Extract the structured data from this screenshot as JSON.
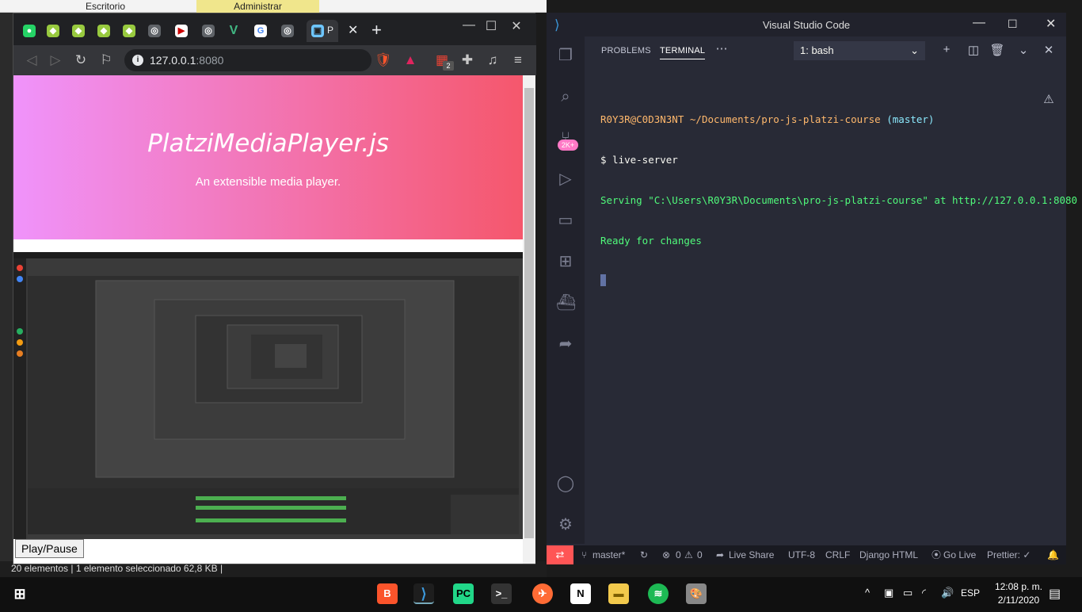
{
  "explorer": {
    "location": "Escritorio",
    "ribbon_tab": "Administrar",
    "status": "20 elementos  |  1 elemento seleccionado  62,8 KB  |"
  },
  "chrome": {
    "tab_active_letter": "P",
    "url_host": "127.0.0.1",
    "url_port": ":8080",
    "extension_badge": "2"
  },
  "page": {
    "title": "PlatziMediaPlayer.js",
    "subtitle": "An extensible media player.",
    "play_button": "Play/Pause"
  },
  "vscode": {
    "window_title": "Visual Studio Code",
    "panel_tabs": [
      "PROBLEMS",
      "TERMINAL"
    ],
    "shell": "1: bash",
    "activity_badge": "2K+",
    "terminal": {
      "user": "R0Y3R@C0D3N3NT",
      "path": "~/Documents/pro-js-platzi-course",
      "branch": "(master)",
      "command": "$ live-server",
      "serving": "Serving \"C:\\Users\\R0Y3R\\Documents\\pro-js-platzi-course\" at http://127.0.0.1:8080",
      "ready": "Ready for changes"
    },
    "status": {
      "branch": "master*",
      "errors": "0",
      "warnings": "0",
      "live_share": "Live Share",
      "encoding": "UTF-8",
      "eol": "CRLF",
      "language": "Django HTML",
      "go_live": "Go Live",
      "prettier": "Prettier: ✓"
    }
  },
  "taskbar": {
    "lang": "ESP",
    "time": "12:08 p. m.",
    "date": "2/11/2020"
  },
  "colors": {
    "hero_start": "#f093fb",
    "hero_end": "#f5576c",
    "term_pink": "#ffb86c",
    "term_cyan": "#8be9fd",
    "term_green": "#50fa7b",
    "vs_bg": "#282a36"
  }
}
